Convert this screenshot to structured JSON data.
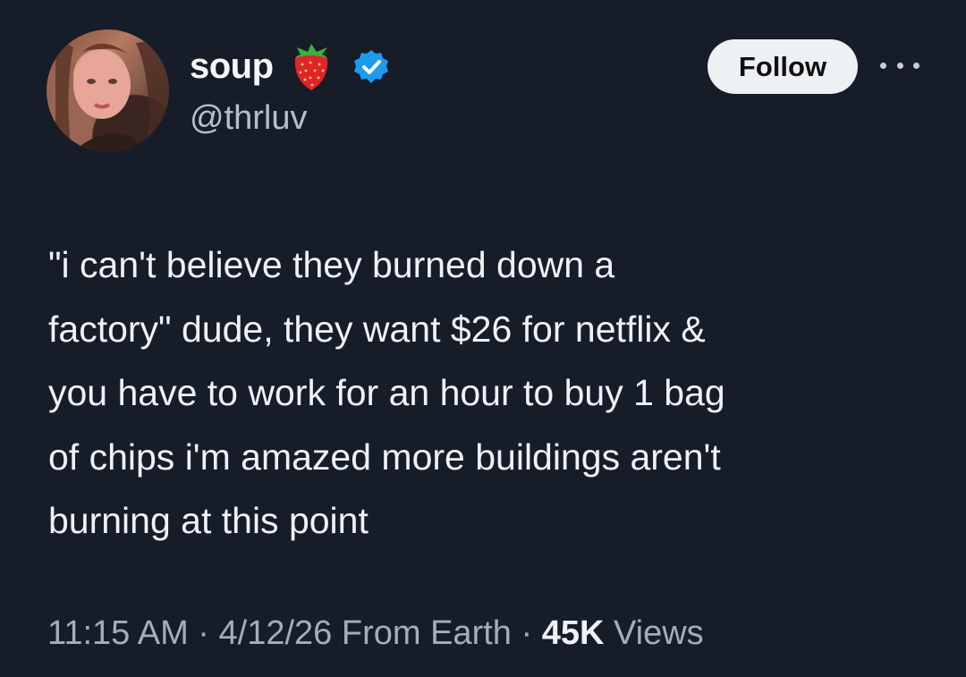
{
  "author": {
    "display_name": "soup",
    "name_emoji": "strawberry-icon",
    "verified_icon": "verified-badge-icon",
    "handle": "@thrluv",
    "avatar_icon": "avatar-photo"
  },
  "actions": {
    "follow_label": "Follow",
    "more_icon": "ellipsis-icon"
  },
  "tweet": {
    "text": "\"i can't believe they burned down a\nfactory\" dude, they want $26 for netflix &\nyou have to work for an hour to buy 1 bag\nof chips i'm amazed more buildings aren't\nburning at this point"
  },
  "meta": {
    "time": "11:15 AM",
    "separator": "·",
    "date": "4/12/26",
    "source": "From Earth",
    "views_count": "45K",
    "views_label": "Views"
  },
  "colors": {
    "background": "#161d29",
    "verified": "#1d9bf0",
    "follow_bg": "#eef1f4"
  }
}
